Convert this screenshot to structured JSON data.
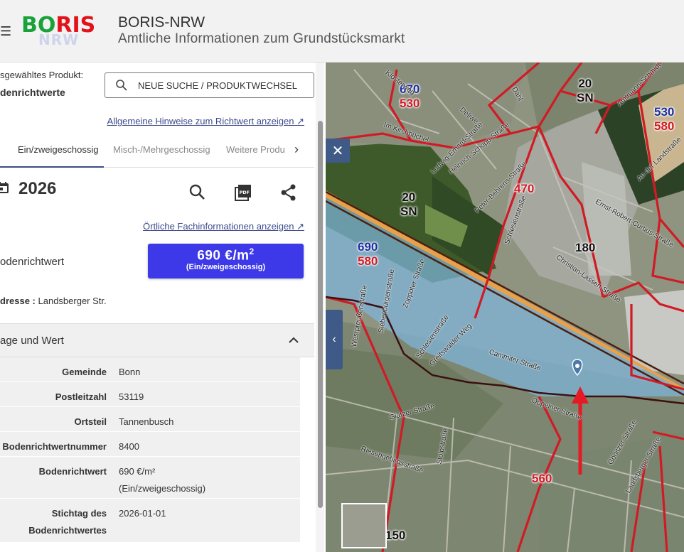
{
  "header": {
    "logo_part1": "BO",
    "logo_part2": "RIS",
    "logo_sub": "NRW",
    "title": "BORIS-NRW",
    "subtitle": "Amtliche Informationen zum Grundstücksmarkt"
  },
  "product": {
    "label": "sgewähltes Produkt:",
    "name": "denrichtwerte",
    "search_button": "NEUE SUCHE / PRODUKTWECHSEL"
  },
  "links": {
    "hint": "Allgemeine Hinweise zum Richtwert anzeigen ↗",
    "fach": "Örtliche Fachinformationen anzeigen ↗"
  },
  "tabs": [
    {
      "label": "Ein/zweigeschossig",
      "active": true
    },
    {
      "label": "Misch-/Mehrgeschossig",
      "active": false
    },
    {
      "label": "Weitere Produ",
      "active": false
    }
  ],
  "year": "2026",
  "richtwert": {
    "label": "odenrichtwert",
    "value": "690 €/m",
    "value_sup": "2",
    "sub": "(Ein/zweigeschossig)"
  },
  "address": {
    "label": "dresse :",
    "value": "Landsberger Str."
  },
  "section": {
    "title": "age und Wert"
  },
  "details": [
    {
      "key": "Gemeinde",
      "value": "Bonn"
    },
    {
      "key": "Postleitzahl",
      "value": "53119"
    },
    {
      "key": "Ortsteil",
      "value": "Tannenbusch"
    },
    {
      "key": "Bodenrichtwertnummer",
      "value": "8400"
    },
    {
      "key": "Bodenrichtwert",
      "value": "690 €/m²",
      "value2": "(Ein/zweigeschossig)"
    },
    {
      "key": "Stichtag des",
      "key2": "Bodenrichtwertes",
      "value": "2026-01-01"
    }
  ],
  "map": {
    "labels": [
      {
        "top": "670",
        "bottom": "530"
      },
      {
        "top": "20",
        "bottom": "SN"
      },
      {
        "top": "530",
        "bottom": "580"
      },
      {
        "top": "20",
        "bottom": "SN"
      },
      {
        "single": "470"
      },
      {
        "top": "690",
        "bottom": "580"
      },
      {
        "single": "180"
      },
      {
        "single": "560"
      },
      {
        "single": "150"
      }
    ],
    "streets": [
      "Klosterweg",
      "Im Kirchbüchel",
      "Dahl",
      "Ludwig-Erhard-Straße",
      "Heinrich-Schopp-Straße",
      "Deliwe",
      "Peter-Behrens-Straße",
      "Ernst-Robert-Curtius-Straße",
      "Christian-Lassen-Straße",
      "Westpreußenstraße",
      "Siebenbürgenstraße",
      "Zoppoter Straße",
      "Schlesienstraße",
      "Greifswalder Weg",
      "Cammiter Straße",
      "Oppelner Straße",
      "Glatzer Straße",
      "Stolpstraße",
      "Riesengebirgsstraße",
      "Görlitzer Straße",
      "Landsberger Straße",
      "Amtmann-Schmidt",
      "An der Landstraße",
      "Schlesienstraße"
    ]
  },
  "colors": {
    "accent": "#3d39e8",
    "link": "#3d4a8a",
    "boundary": "#d21a24",
    "map_button": "#3f5a86"
  }
}
